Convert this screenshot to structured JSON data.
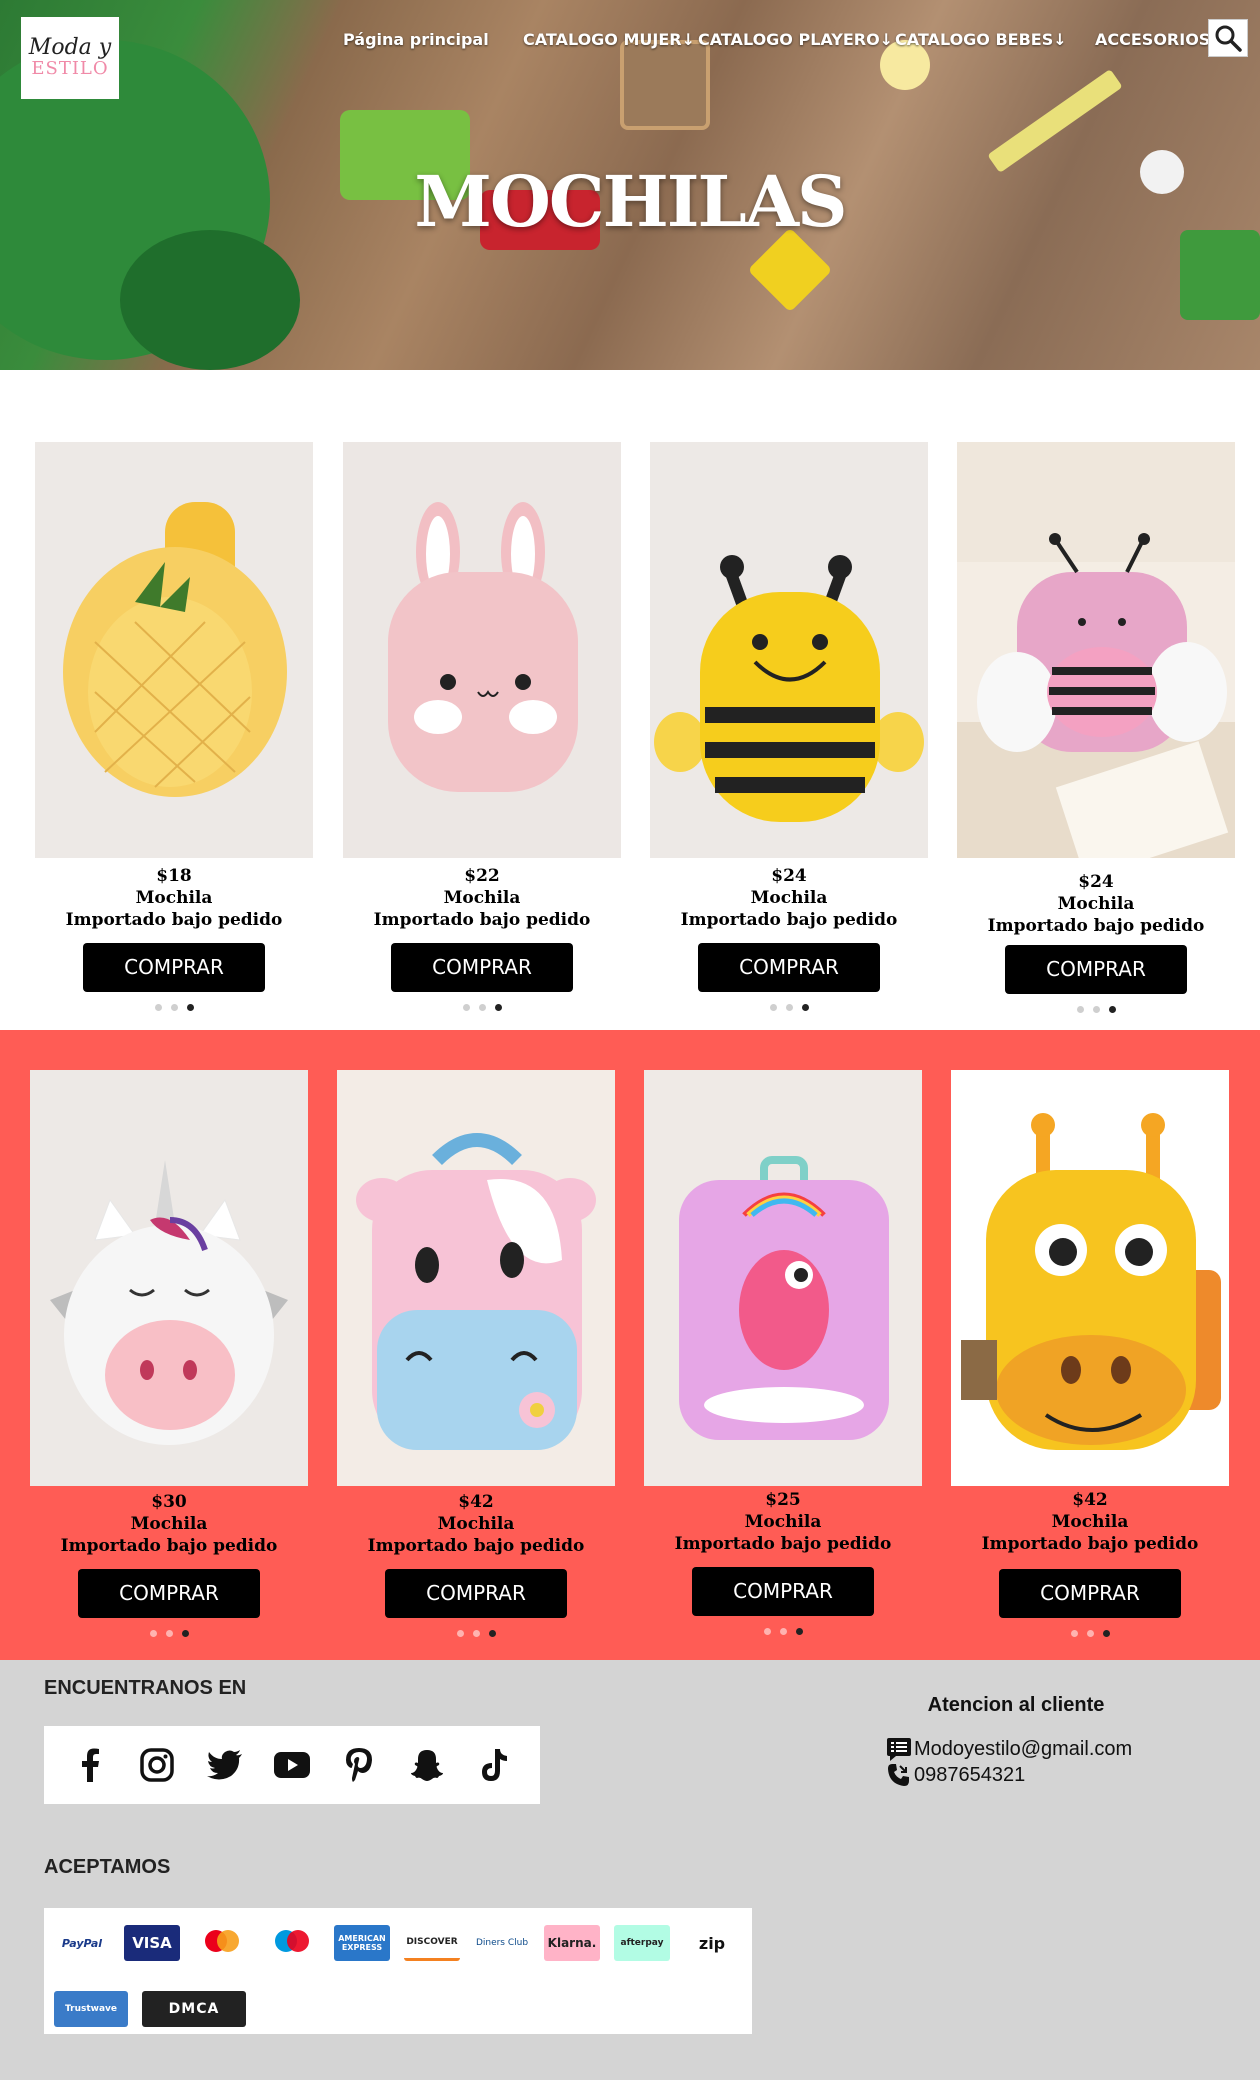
{
  "brand": {
    "line1": "Moda y",
    "line2": "ESTILO"
  },
  "nav": {
    "items": [
      {
        "label": "Página principal"
      },
      {
        "label": "CATALOGO MUJER↓"
      },
      {
        "label": "CATALOGO PLAYERO↓"
      },
      {
        "label": "CATALOGO BEBES↓"
      },
      {
        "label": "ACCESORIOS↓"
      }
    ]
  },
  "hero": {
    "title": "MOCHILAS"
  },
  "products": [
    {
      "price": "$18",
      "name": "Mochila",
      "note": "Importado bajo pedido",
      "button": "COMPRAR",
      "image": "pineapple-backpack",
      "color": "#f7cf62"
    },
    {
      "price": "$22",
      "name": "Mochila",
      "note": "Importado bajo pedido",
      "button": "COMPRAR",
      "image": "bunny-backpack",
      "color": "#f2bfc4"
    },
    {
      "price": "$24",
      "name": "Mochila",
      "note": "Importado bajo pedido",
      "button": "COMPRAR",
      "image": "bee-backpack",
      "color": "#f6cd1c"
    },
    {
      "price": "$24",
      "name": "Mochila",
      "note": "Importado bajo pedido",
      "button": "COMPRAR",
      "image": "pink-bee-backpack",
      "color": "#e7a6c8"
    },
    {
      "price": "$30",
      "name": "Mochila",
      "note": "Importado bajo pedido",
      "button": "COMPRAR",
      "image": "unicorn-backpack",
      "color": "#f6f6f6"
    },
    {
      "price": "$42",
      "name": "Mochila",
      "note": "Importado bajo pedido",
      "button": "COMPRAR",
      "image": "cow-backpack",
      "color": "#f7c3d6"
    },
    {
      "price": "$25",
      "name": "Mochila",
      "note": "Importado bajo pedido",
      "button": "COMPRAR",
      "image": "dinosaur-backpack",
      "color": "#e6a6e6"
    },
    {
      "price": "$42",
      "name": "Mochila",
      "note": "Importado bajo pedido",
      "button": "COMPRAR",
      "image": "giraffe-backpack",
      "color": "#f7c41f"
    }
  ],
  "footer": {
    "social_heading": "ENCUENTRANOS EN",
    "social": [
      "facebook-icon",
      "instagram-icon",
      "twitter-icon",
      "youtube-icon",
      "pinterest-icon",
      "snapchat-icon",
      "tiktok-icon"
    ],
    "payments_heading": "ACEPTAMOS",
    "payments": [
      "PayPal",
      "VISA",
      "mastercard",
      "maestro",
      "AMERICAN EXPRESS",
      "DISCOVER",
      "Diners Club",
      "Klarna.",
      "afterpay",
      "zip",
      "Trustwave",
      "DMCA"
    ],
    "contact_heading": "Atencion al cliente",
    "email": "Modoyestilo@gmail.com",
    "phone": "0987654321"
  }
}
